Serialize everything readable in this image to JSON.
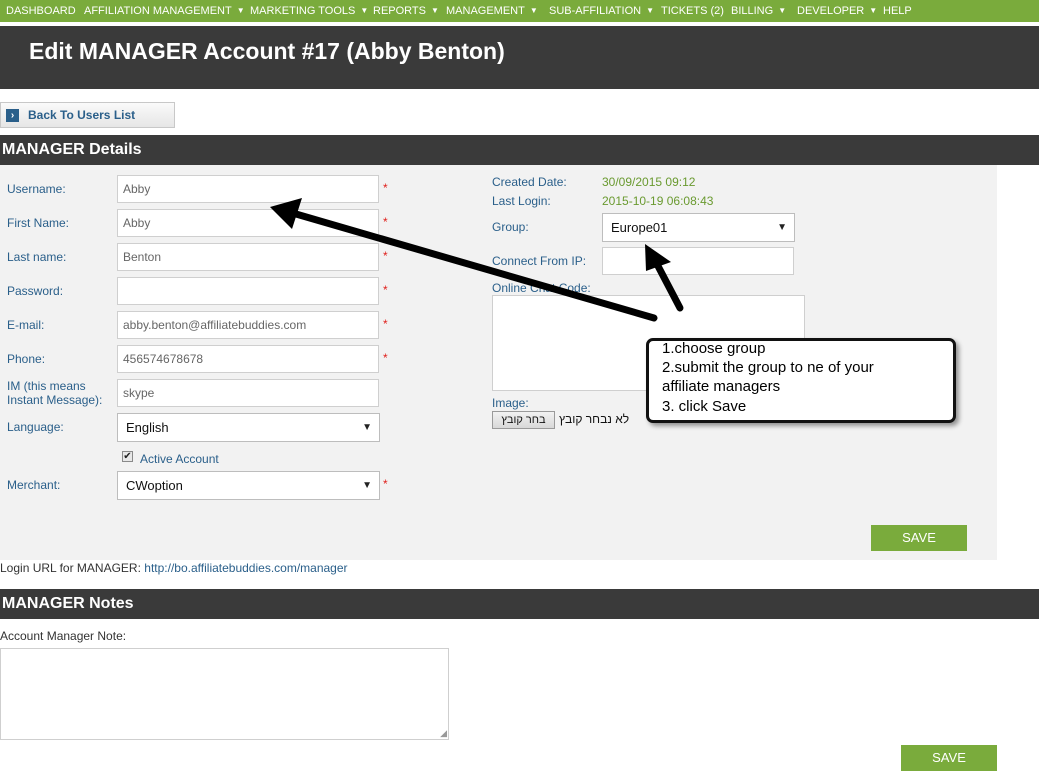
{
  "nav": {
    "items": [
      {
        "label": "DASHBOARD",
        "caret": false
      },
      {
        "label": "AFFILIATION MANAGEMENT",
        "caret": true
      },
      {
        "label": "MARKETING TOOLS",
        "caret": true
      },
      {
        "label": "REPORTS",
        "caret": true
      },
      {
        "label": "MANAGEMENT",
        "caret": true
      },
      {
        "label": "SUB-AFFILIATION",
        "caret": true
      },
      {
        "label": "TICKETS (2)",
        "caret": false
      },
      {
        "label": "BILLING",
        "caret": true
      },
      {
        "label": "DEVELOPER",
        "caret": true
      },
      {
        "label": "HELP",
        "caret": false
      }
    ]
  },
  "page": {
    "title": "Edit MANAGER Account #17 (Abby Benton)"
  },
  "back_button": {
    "label": "Back To Users List"
  },
  "details": {
    "title": "MANAGER Details",
    "fields": {
      "username": {
        "label": "Username:",
        "value": "Abby",
        "required": "*"
      },
      "first_name": {
        "label": "First Name:",
        "value": "Abby",
        "required": "*"
      },
      "last_name": {
        "label": "Last name:",
        "value": "Benton",
        "required": "*"
      },
      "password": {
        "label": "Password:",
        "value": "",
        "required": "*"
      },
      "email": {
        "label": "E-mail:",
        "value": "abby.benton@affiliatebuddies.com",
        "required": "*"
      },
      "phone": {
        "label": "Phone:",
        "value": "456574678678",
        "required": "*"
      },
      "im": {
        "label_line1": "IM (this means",
        "label_line2": "Instant Message):",
        "value": "skype"
      },
      "language": {
        "label": "Language:",
        "value": "English"
      },
      "active_account": {
        "label": "Active Account",
        "checked": true
      },
      "merchant": {
        "label": "Merchant:",
        "value": "CWoption",
        "required": "*"
      }
    },
    "right": {
      "created_date": {
        "label": "Created Date:",
        "value": "30/09/2015 09:12"
      },
      "last_login": {
        "label": "Last Login:",
        "value": "2015-10-19 06:08:43"
      },
      "group": {
        "label": "Group:",
        "value": "Europe01"
      },
      "connect_ip": {
        "label": "Connect From IP:",
        "value": ""
      },
      "online_chat": {
        "label": "Online Chat Code:"
      },
      "image": {
        "label": "Image:",
        "button": "בחר קובץ",
        "status": "לא נבחר קובץ"
      }
    },
    "save_label": "SAVE"
  },
  "login_url": {
    "prefix": "Login URL for MANAGER:",
    "link": "http://bo.affiliatebuddies.com/manager"
  },
  "notes": {
    "title": "MANAGER Notes",
    "note_label": "Account Manager Note:",
    "save_label": "SAVE"
  },
  "callout": {
    "lines": [
      "1.choose group",
      "2.submit the group to ne of your",
      "affiliate managers",
      "3. click Save"
    ]
  },
  "colors": {
    "accent": "#7aab3c",
    "header_bg": "#3a3a3a",
    "label_blue": "#2a5f8a",
    "value_green": "#6a9a30",
    "required_red": "#e0201c"
  }
}
